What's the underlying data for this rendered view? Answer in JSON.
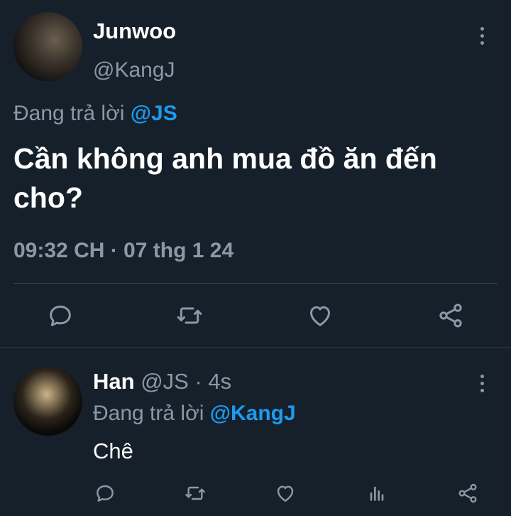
{
  "main_tweet": {
    "display_name": "Junwoo",
    "handle": "@KangJ",
    "replying_prefix": "Đang trả lời ",
    "replying_mention": "@JS",
    "text": "Cần không anh mua đồ ăn đến cho?",
    "timestamp": "09:32 CH · 07 thg 1 24"
  },
  "reply": {
    "display_name": "Han",
    "meta": "@JS · 4s",
    "replying_prefix": "Đang trả lời ",
    "replying_mention": "@KangJ",
    "text": "Chê"
  },
  "icons": [
    "comment-icon",
    "retweet-icon",
    "like-icon",
    "share-icon",
    "analytics-icon",
    "more-icon"
  ],
  "colors": {
    "background": "#15202b",
    "text": "#ffffff",
    "secondary": "#8b98a5",
    "accent": "#1d9bf0",
    "divider": "#38444d"
  }
}
